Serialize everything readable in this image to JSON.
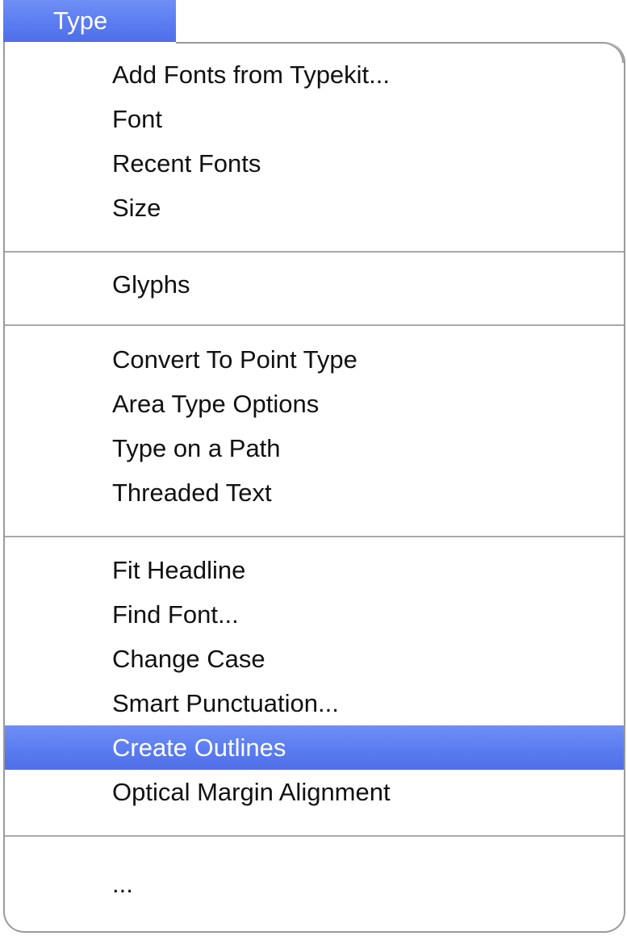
{
  "menu": {
    "title": "Type",
    "groups": [
      {
        "items": [
          {
            "label": "Add Fonts from Typekit..."
          },
          {
            "label": "Font"
          },
          {
            "label": "Recent Fonts"
          },
          {
            "label": "Size"
          }
        ]
      },
      {
        "items": [
          {
            "label": "Glyphs"
          }
        ]
      },
      {
        "items": [
          {
            "label": "Convert To Point Type"
          },
          {
            "label": "Area Type Options"
          },
          {
            "label": "Type on a Path"
          },
          {
            "label": "Threaded Text"
          }
        ]
      },
      {
        "items": [
          {
            "label": "Fit Headline"
          },
          {
            "label": "Find Font..."
          },
          {
            "label": "Change Case"
          },
          {
            "label": "Smart Punctuation..."
          },
          {
            "label": "Create Outlines",
            "highlighted": true
          },
          {
            "label": "Optical Margin Alignment"
          }
        ]
      },
      {
        "items": [
          {
            "label": "..."
          }
        ]
      }
    ]
  },
  "colors": {
    "highlight": "#5b7cf0",
    "separator": "#a8a8a8",
    "border": "#9a9a9a",
    "text": "#111111"
  }
}
